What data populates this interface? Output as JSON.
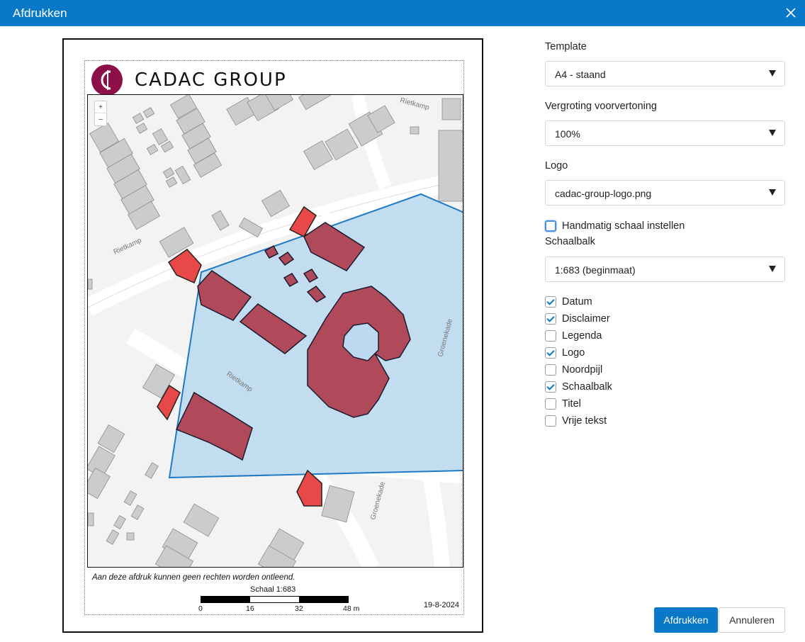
{
  "window": {
    "title": "Afdrukken"
  },
  "preview": {
    "logo_text": "CADAC GROUP",
    "map": {
      "street_labels": [
        "Rietkamp",
        "Rietkamp",
        "Rietkamp",
        "Groenekade",
        "Groenekade"
      ],
      "zoom_in": "+",
      "zoom_out": "–"
    },
    "disclaimer": "Aan deze afdruk kunnen geen rechten worden ontleend.",
    "scale_title": "Schaal 1:683",
    "scale_labels": [
      "0",
      "16",
      "32",
      "48 m"
    ],
    "date": "19-8-2024"
  },
  "form": {
    "template_label": "Template",
    "template_value": "A4 - staand",
    "zoom_label": "Vergroting voorvertoning",
    "zoom_value": "100%",
    "logo_label": "Logo",
    "logo_value": "cadac-group-logo.png",
    "manual_scale_label": "Handmatig schaal instellen",
    "scalebar_label": "Schaalbalk",
    "scalebar_value": "1:683 (beginmaat)",
    "options": [
      {
        "label": "Datum",
        "checked": true
      },
      {
        "label": "Disclaimer",
        "checked": true
      },
      {
        "label": "Legenda",
        "checked": false
      },
      {
        "label": "Logo",
        "checked": true
      },
      {
        "label": "Noordpijl",
        "checked": false
      },
      {
        "label": "Schaalbalk",
        "checked": true
      },
      {
        "label": "Titel",
        "checked": false
      },
      {
        "label": "Vrije tekst",
        "checked": false
      }
    ]
  },
  "buttons": {
    "print": "Afdrukken",
    "cancel": "Annuleren"
  },
  "colors": {
    "accent": "#0a78c8",
    "logo": "#8c0f4a",
    "selection_fill": "#bcd9ef",
    "selection_stroke": "#1f7ac6",
    "parcel_selected": "#b04a5a",
    "parcel_highlight": "#e84848",
    "building": "#cccccc"
  }
}
